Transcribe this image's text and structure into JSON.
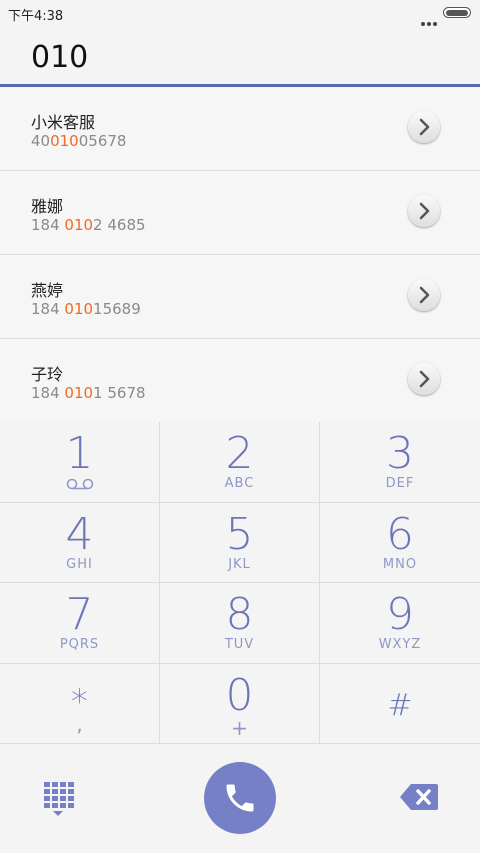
{
  "status_bar": {
    "time": "下午4:38"
  },
  "dialer": {
    "input": "010"
  },
  "results": [
    {
      "name": "小米客服",
      "number_before": "40",
      "number_match": "010",
      "number_after": "05678"
    },
    {
      "name": "雅娜",
      "number_before": "184 ",
      "number_match": "010",
      "number_after": "2 4685"
    },
    {
      "name": "燕婷",
      "number_before": "184 ",
      "number_match": "010",
      "number_after": "15689"
    },
    {
      "name": "子玲",
      "number_before": "184 ",
      "number_match": "010",
      "number_after": "1 5678"
    }
  ],
  "keypad": [
    {
      "digit": "1",
      "letters": "",
      "icon": "voicemail-icon"
    },
    {
      "digit": "2",
      "letters": "ABC"
    },
    {
      "digit": "3",
      "letters": "DEF"
    },
    {
      "digit": "4",
      "letters": "GHI"
    },
    {
      "digit": "5",
      "letters": "JKL"
    },
    {
      "digit": "6",
      "letters": "MNO"
    },
    {
      "digit": "7",
      "letters": "PQRS"
    },
    {
      "digit": "8",
      "letters": "TUV"
    },
    {
      "digit": "9",
      "letters": "WXYZ"
    },
    {
      "digit": "*",
      "letters": ","
    },
    {
      "digit": "0",
      "letters": "+"
    },
    {
      "digit": "#",
      "letters": ""
    }
  ],
  "icons": {
    "detail": "chevron-right-icon",
    "dialpad": "dialpad-grid-icon",
    "call": "phone-icon",
    "delete": "backspace-icon"
  },
  "colors": {
    "accent": "#7580c6",
    "highlight": "#f06a24",
    "input_line": "#5b67ac"
  }
}
